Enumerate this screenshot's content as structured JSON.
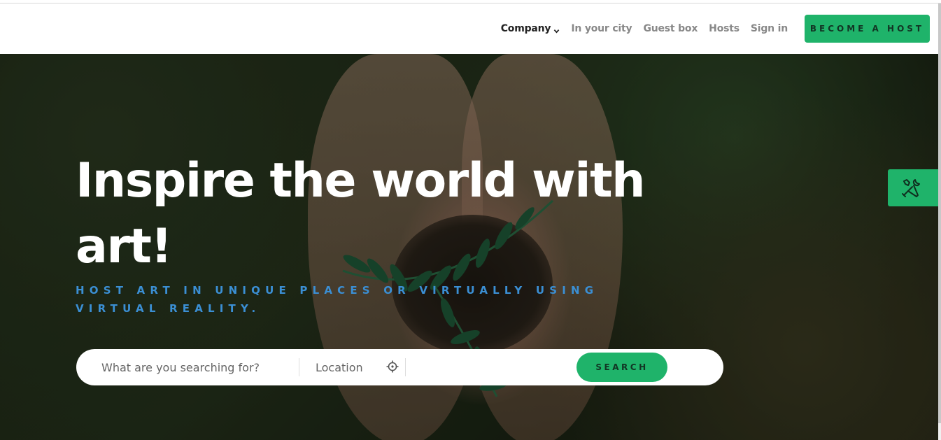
{
  "header": {
    "nav": [
      {
        "label": "Company",
        "active": true,
        "has_dropdown": true
      },
      {
        "label": "In your city",
        "active": false
      },
      {
        "label": "Guest box",
        "active": false
      },
      {
        "label": "Hosts",
        "active": false
      },
      {
        "label": "Sign in",
        "active": false
      }
    ],
    "cta_label": "BECOME A HOST"
  },
  "hero": {
    "title": "Inspire the world with art!",
    "subtitle": "Host art in unique places or virtually using virtual reality."
  },
  "search": {
    "query_placeholder": "What are you searching for?",
    "query_value": "",
    "location_placeholder": "Location",
    "location_value": "",
    "button_label": "SEARCH"
  },
  "icons": {
    "dropdown": "chevron-down-icon",
    "locate": "crosshair-icon",
    "tools": "tools-icon"
  },
  "colors": {
    "accent": "#1fb36a",
    "subtitle": "#3b8fd4",
    "nav_active": "#222222",
    "nav_inactive": "#888888"
  }
}
